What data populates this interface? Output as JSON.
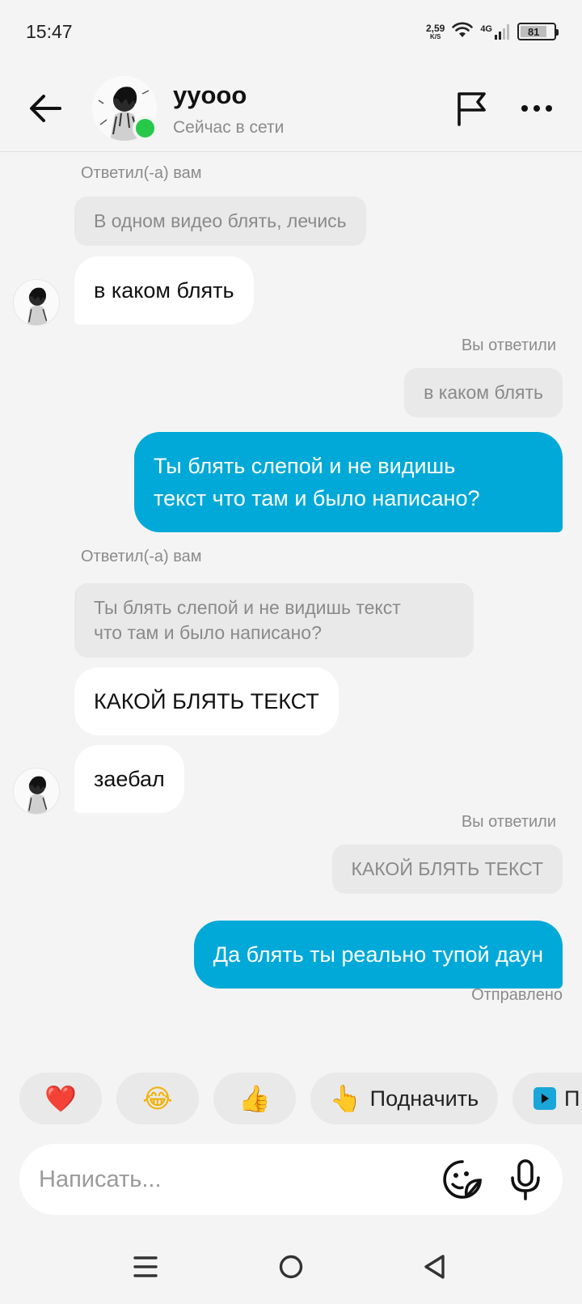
{
  "status_bar": {
    "time": "15:47",
    "net_speed": "2,59",
    "net_unit": "K/S",
    "network": "4G",
    "battery": "81",
    "battery_level": 0.81
  },
  "header": {
    "name": "yyooo",
    "status": "Сейчас в сети",
    "online_color": "#27c94a"
  },
  "messages": {
    "caption_replied_them_1": "Ответил(-а) вам",
    "quote_1": "В одном видео блять, лечись",
    "in_1": "в каком блять",
    "caption_replied_you_1": "Вы ответили",
    "quote_2": "в каком блять",
    "out_1_line1": "Ты блять слепой и не видишь",
    "out_1_line2": "текст что там и было написано?",
    "caption_replied_them_2": "Ответил(-а) вам",
    "quote_3_line1": "Ты блять слепой и не видишь текст",
    "quote_3_line2": "что там и было написано?",
    "in_2": "КАКОЙ БЛЯТЬ ТЕКСТ",
    "in_3": "заебал",
    "caption_replied_you_2": "Вы ответили",
    "quote_4": "КАКОЙ БЛЯТЬ ТЕКСТ",
    "out_2": "Да блять ты реально тупой даун",
    "sent_status": "Отправлено"
  },
  "colors": {
    "outgoing_bubble": "#00a9d8",
    "incoming_bubble": "#ffffff",
    "quote_bg": "#e9e9e9",
    "background": "#f4f4f4"
  },
  "reactions": {
    "heart": "❤️",
    "laugh": "😂",
    "thumbs_up": "👍",
    "nudge_emoji": "👆",
    "nudge_label": "Подначить",
    "partial_label": "П"
  },
  "composer": {
    "placeholder": "Написать..."
  },
  "icons": {
    "back": "arrow-left-icon",
    "flag": "flag-icon",
    "more": "more-horizontal-icon",
    "sticker": "sticker-smile-icon",
    "mic": "microphone-icon",
    "nav_menu": "menu-icon",
    "nav_home": "home-circle-icon",
    "nav_back": "triangle-back-icon"
  }
}
